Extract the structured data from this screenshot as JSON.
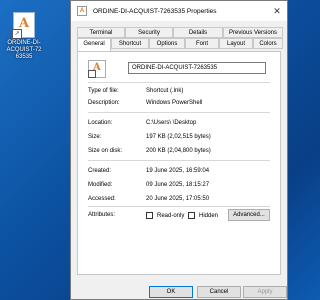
{
  "desktop": {
    "icon_label": "ORDINE-DI-ACQUIST-7263535"
  },
  "window": {
    "title": "ORDINE-DI-ACQUIST-7263535 Properties",
    "close_glyph": "✕"
  },
  "tabs": {
    "row1": [
      "Terminal",
      "Security",
      "Details",
      "Previous Versions"
    ],
    "row2": [
      "General",
      "Shortcut",
      "Options",
      "Font",
      "Layout",
      "Colors"
    ],
    "active": "General"
  },
  "general": {
    "file_name": "ORDINE-DI-ACQUIST-7263535",
    "fields": [
      {
        "label": "Type of file:",
        "value": "Shortcut (.lnk)"
      },
      {
        "label": "Description:",
        "value": "Windows PowerShell"
      },
      {
        "label": "Location:",
        "value": "C:\\Users\\        \\Desktop"
      },
      {
        "label": "Size:",
        "value": "197 KB (2,02,515 bytes)"
      },
      {
        "label": "Size on disk:",
        "value": "200 KB (2,04,800 bytes)"
      },
      {
        "label": "Created:",
        "value": "19 June 2025, 16:59:04"
      },
      {
        "label": "Modified:",
        "value": "09 June 2025, 18:15:27"
      },
      {
        "label": "Accessed:",
        "value": "20 June 2025, 17:05:50"
      }
    ],
    "attributes_label": "Attributes:",
    "read_only_label": "Read-only",
    "hidden_label": "Hidden",
    "advanced_label": "Advanced..."
  },
  "buttons": {
    "ok": "OK",
    "cancel": "Cancel",
    "apply": "Apply"
  }
}
